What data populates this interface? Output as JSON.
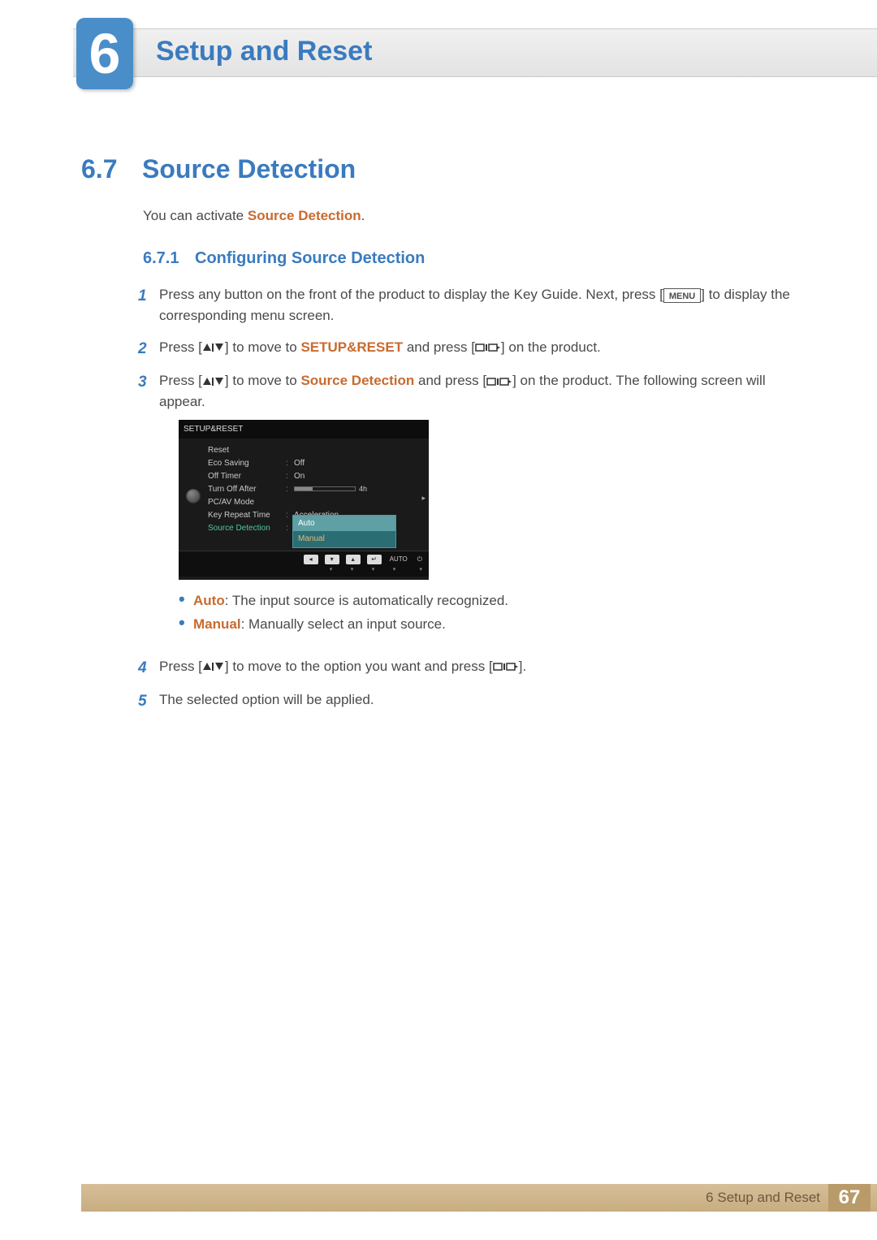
{
  "chapter": {
    "num": "6",
    "title": "Setup and Reset"
  },
  "section": {
    "num": "6.7",
    "title": "Source Detection"
  },
  "intro": {
    "before": "You can activate ",
    "hl": "Source Detection",
    "after": "."
  },
  "subsection": {
    "num": "6.7.1",
    "title": "Configuring Source Detection"
  },
  "steps": {
    "s1": {
      "num": "1",
      "t1": "Press any button on the front of the product to display the Key Guide. Next, press [",
      "menu": "MENU",
      "t2": "] to display the corresponding menu screen."
    },
    "s2": {
      "num": "2",
      "t1": "Press [",
      "t2": "] to move to ",
      "hl": "SETUP&RESET",
      "t3": " and press [",
      "t4": "] on the product."
    },
    "s3": {
      "num": "3",
      "t1": "Press [",
      "t2": "] to move to ",
      "hl": "Source Detection",
      "t3": " and press [",
      "t4": "] on the product. The following screen will appear."
    },
    "s4": {
      "num": "4",
      "t1": "Press [",
      "t2": "] to move to the option you want and press [",
      "t3": "]."
    },
    "s5": {
      "num": "5",
      "t1": "The selected option will be applied."
    }
  },
  "bullets": {
    "auto": {
      "hl": "Auto",
      "t": ": The input source is automatically recognized."
    },
    "manual": {
      "hl": "Manual",
      "t": ": Manually select an input source."
    }
  },
  "osd": {
    "title": "SETUP&RESET",
    "rows": {
      "reset": "Reset",
      "eco": "Eco Saving",
      "eco_v": "Off",
      "offtimer": "Off Timer",
      "offtimer_v": "On",
      "turnoff": "Turn Off After",
      "turnoff_v": "4h",
      "pcav": "PC/AV Mode",
      "keyrep": "Key Repeat Time",
      "keyrep_v": "Acceleration",
      "srcdet": "Source Detection"
    },
    "dropdown": {
      "auto": "Auto",
      "manual": "Manual"
    },
    "footer": {
      "auto": "AUTO"
    }
  },
  "footer": {
    "text": "6 Setup and Reset",
    "page": "67"
  }
}
